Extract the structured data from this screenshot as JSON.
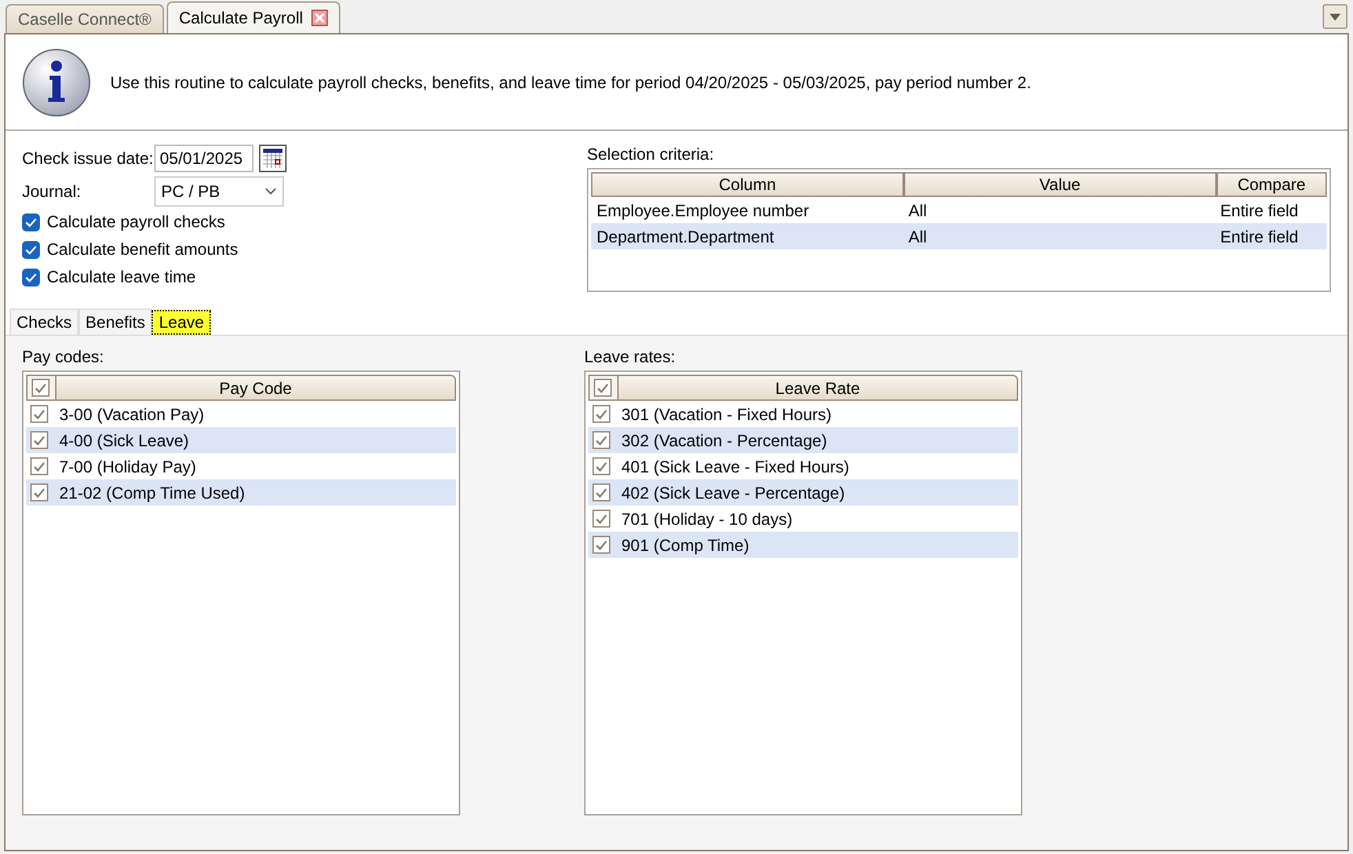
{
  "tabs": [
    {
      "label": "Caselle Connect®",
      "selected": false,
      "closable": false
    },
    {
      "label": "Calculate Payroll",
      "selected": true,
      "closable": true
    }
  ],
  "info": {
    "message": "Use this routine to calculate payroll checks, benefits, and leave time for period 04/20/2025 - 05/03/2025, pay period number 2."
  },
  "form": {
    "check_issue_date": {
      "label": "Check issue date:",
      "value": "05/01/2025"
    },
    "journal": {
      "label": "Journal:",
      "value": "PC / PB"
    },
    "options": [
      {
        "label": "Calculate payroll checks",
        "checked": true
      },
      {
        "label": "Calculate benefit amounts",
        "checked": true
      },
      {
        "label": "Calculate leave time",
        "checked": true
      }
    ]
  },
  "selection_criteria": {
    "label": "Selection criteria:",
    "columns": [
      "Column",
      "Value",
      "Compare"
    ],
    "rows": [
      [
        "Employee.Employee number",
        "All",
        "Entire field"
      ],
      [
        "Department.Department",
        "All",
        "Entire field"
      ]
    ]
  },
  "sub_tabs": [
    {
      "label": "Checks",
      "selected": false
    },
    {
      "label": "Benefits",
      "selected": false
    },
    {
      "label": "Leave",
      "selected": true
    }
  ],
  "pay_codes": {
    "label": "Pay codes:",
    "column": "Pay Code",
    "all_checked": true,
    "items": [
      {
        "label": "3-00 (Vacation Pay)",
        "checked": true
      },
      {
        "label": "4-00 (Sick Leave)",
        "checked": true
      },
      {
        "label": "7-00 (Holiday Pay)",
        "checked": true
      },
      {
        "label": "21-02 (Comp Time Used)",
        "checked": true
      }
    ]
  },
  "leave_rates": {
    "label": "Leave rates:",
    "column": "Leave Rate",
    "all_checked": true,
    "items": [
      {
        "label": "301 (Vacation - Fixed Hours)",
        "checked": true
      },
      {
        "label": "302 (Vacation - Percentage)",
        "checked": true
      },
      {
        "label": "401 (Sick Leave - Fixed Hours)",
        "checked": true
      },
      {
        "label": "402 (Sick Leave - Percentage)",
        "checked": true
      },
      {
        "label": "701 (Holiday - 10 days)",
        "checked": true
      },
      {
        "label": "901 (Comp Time)",
        "checked": true
      }
    ]
  }
}
